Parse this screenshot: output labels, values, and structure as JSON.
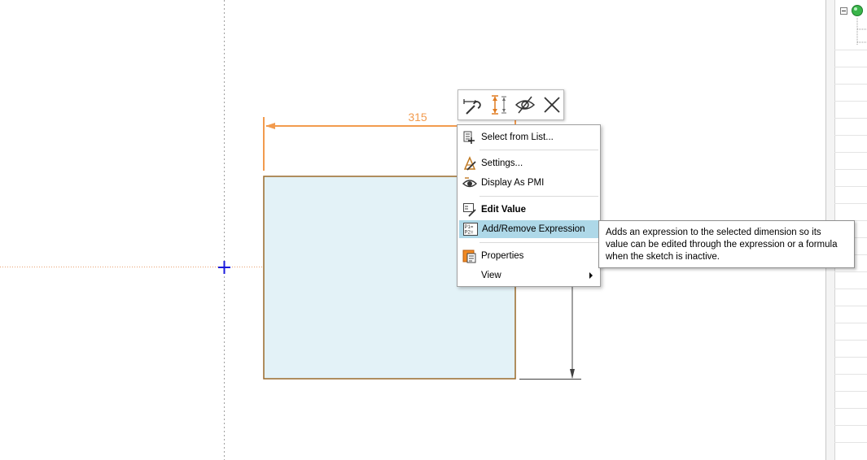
{
  "dimension": {
    "value": "315"
  },
  "mini_toolbar": {
    "buttons": [
      {
        "icon": "edit-dimension-icon"
      },
      {
        "icon": "alternate-dimension-icon"
      },
      {
        "icon": "hide-icon"
      },
      {
        "icon": "delete-icon"
      }
    ]
  },
  "context_menu": {
    "items": [
      {
        "label": "Select from List...",
        "icon": "select-from-list-icon"
      },
      {
        "label": "Settings...",
        "icon": "settings-icon"
      },
      {
        "label": "Display As PMI",
        "icon": "display-pmi-icon"
      },
      {
        "label": "Edit Value",
        "icon": "edit-value-icon"
      },
      {
        "label": "Add/Remove Expression",
        "icon": "expression-icon"
      },
      {
        "label": "Properties",
        "icon": "properties-icon"
      },
      {
        "label": "View",
        "icon": ""
      }
    ]
  },
  "tooltip": {
    "lines": [
      "Adds an expression to the selected dimension so its",
      "value can be edited through the expression or a formula",
      "when the sketch is inactive."
    ]
  },
  "colors": {
    "dimension": "#f29b4e",
    "sketch_outline": "#9a6a2a",
    "sketch_fill": "#e3f2f7",
    "highlight": "#aed8e8",
    "origin_cross": "#1a1adc"
  }
}
